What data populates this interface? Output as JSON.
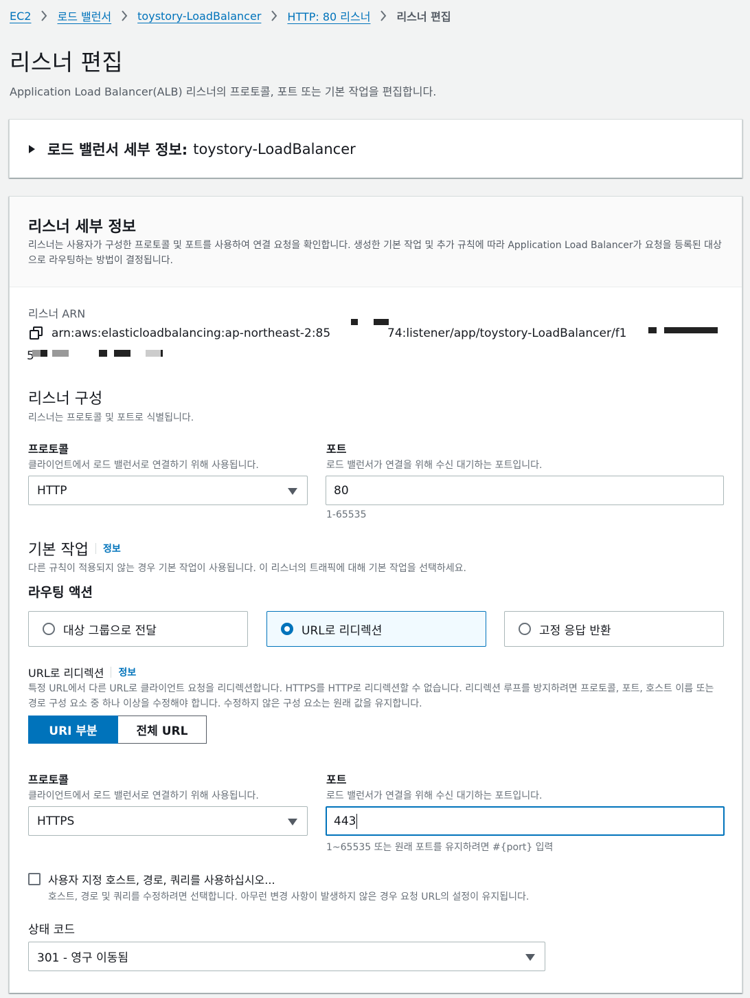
{
  "breadcrumb": {
    "items": [
      "EC2",
      "로드 밸런서",
      "toystory-LoadBalancer",
      "HTTP: 80 리스너"
    ],
    "current": "리스너 편집"
  },
  "page": {
    "title": "리스너 편집",
    "description": "Application Load Balancer(ALB) 리스너의 프로토콜, 포트 또는 기본 작업을 편집합니다."
  },
  "lb_details": {
    "label": "로드 밸런서 세부 정보:",
    "name": "toystory-LoadBalancer"
  },
  "listener_details": {
    "title": "리스너 세부 정보",
    "description": "리스너는 사용자가 구성한 프로토콜 및 포트를 사용하여 연결 요청을 확인합니다. 생성한 기본 작업 및 추가 규칙에 따라 Application Load Balancer가 요청을 등록된 대상으로 라우팅하는 방법이 결정됩니다.",
    "arn_label": "리스너 ARN",
    "arn_part1": "arn:aws:elasticloadbalancing:ap-northeast-2:85",
    "arn_part2": "74:listener/app/toystory-LoadBalancer/f1",
    "arn_part3": "5"
  },
  "listener_config": {
    "title": "리스너 구성",
    "description": "리스너는 프로토콜 및 포트로 식별됩니다.",
    "protocol_label": "프로토콜",
    "protocol_help": "클라이언트에서 로드 밸런서로 연결하기 위해 사용됩니다.",
    "protocol_value": "HTTP",
    "port_label": "포트",
    "port_help": "로드 밸런서가 연결을 위해 수신 대기하는 포트입니다.",
    "port_value": "80",
    "port_range": "1-65535"
  },
  "default_action": {
    "title": "기본 작업",
    "info": "정보",
    "description": "다른 규칙이 적용되지 않는 경우 기본 작업이 사용됩니다. 이 리스너의 트래픽에 대해 기본 작업을 선택하세요.",
    "routing_label": "라우팅 액션",
    "options": [
      "대상 그룹으로 전달",
      "URL로 리디렉션",
      "고정 응답 반환"
    ],
    "selected": "URL로 리디렉션"
  },
  "redirect": {
    "title": "URL로 리디렉션",
    "info": "정보",
    "description": "특정 URL에서 다른 URL로 클라이언트 요청을 리디렉션합니다. HTTPS를 HTTP로 리디렉션할 수 없습니다. 리디렉션 루프를 방지하려면 프로토콜, 포트, 호스트 이름 또는 경로 구성 요소 중 하나 이상을 수정해야 합니다. 수정하지 않은 구성 요소는 원래 값을 유지합니다.",
    "segment_options": [
      "URI 부분",
      "전체 URL"
    ],
    "segment_selected": "URI 부분",
    "protocol_label": "프로토콜",
    "protocol_help": "클라이언트에서 로드 밸런서로 연결하기 위해 사용됩니다.",
    "protocol_value": "HTTPS",
    "port_label": "포트",
    "port_help": "로드 밸런서가 연결을 위해 수신 대기하는 포트입니다.",
    "port_value": "443",
    "port_hint": "1~65535 또는 원래 포트를 유지하려면 #{port} 입력",
    "custom_checkbox_label": "사용자 지정 호스트, 경로, 쿼리를 사용하십시오...",
    "custom_checkbox_help": "호스트, 경로 및 쿼리를 수정하려면 선택합니다. 아무런 변경 사항이 발생하지 않은 경우 요청 URL의 설정이 유지됩니다.",
    "custom_checked": false,
    "status_code_label": "상태 코드",
    "status_code_value": "301 - 영구 이동됨"
  },
  "colors": {
    "link": "#0073bb",
    "primary": "#0073bb",
    "text": "#16191f",
    "muted": "#687078",
    "border": "#aab7b8"
  }
}
